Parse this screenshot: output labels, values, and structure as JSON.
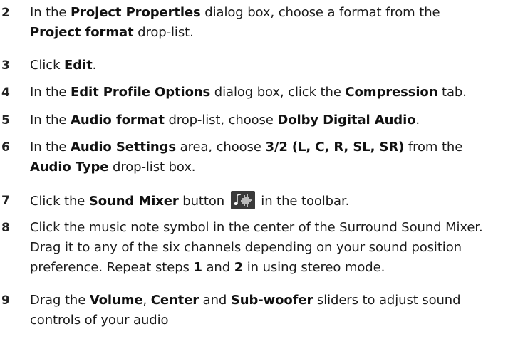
{
  "steps": [
    {
      "num": "2",
      "p": [
        "In the ",
        "Project Properties",
        " dialog box, choose a format from the ",
        "Project format",
        " drop-list."
      ]
    },
    {
      "num": "3",
      "p": [
        "Click ",
        "Edit",
        "."
      ]
    },
    {
      "num": "4",
      "p": [
        "In the ",
        "Edit Profile Options",
        " dialog box, click the ",
        "Compression",
        " tab."
      ]
    },
    {
      "num": "5",
      "p": [
        "In the ",
        "Audio format",
        " drop-list, choose ",
        "Dolby Digital Audio",
        "."
      ]
    },
    {
      "num": "6",
      "p": [
        "In the ",
        "Audio Settings",
        " area, choose ",
        "3/2 (L, C, R, SL, SR)",
        " from the ",
        "Audio Type",
        " drop-list box."
      ]
    },
    {
      "num": "7",
      "p": [
        "Click the ",
        "Sound Mixer",
        " button ",
        " in the toolbar."
      ]
    },
    {
      "num": "8",
      "p": [
        "Click the music note symbol in the center of the Surround Sound Mixer. Drag it to any of the six channels depending on your sound position preference. Repeat steps ",
        "1",
        " and ",
        "2",
        " in using stereo mode."
      ]
    },
    {
      "num": "9",
      "p": [
        "Drag the ",
        "Volume",
        ", ",
        "Center",
        " and ",
        "Sub-woofer",
        " sliders to adjust sound controls of your audio"
      ]
    }
  ],
  "icons": {
    "sound_mixer": "sound-mixer-icon"
  }
}
